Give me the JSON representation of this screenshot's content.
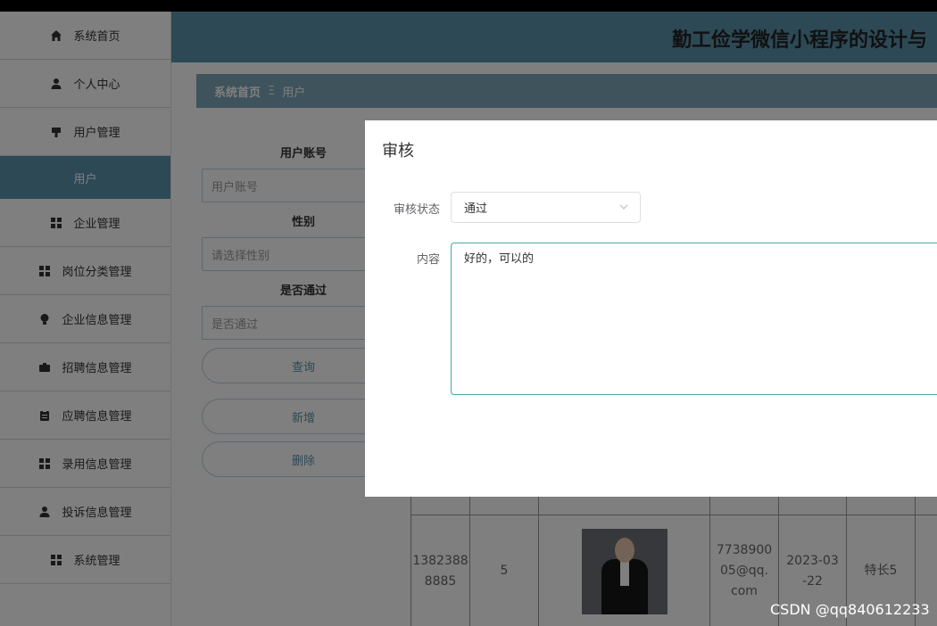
{
  "sidebar": {
    "items": [
      {
        "label": "系统首页",
        "icon": "home-icon"
      },
      {
        "label": "个人中心",
        "icon": "person-icon"
      },
      {
        "label": "用户管理",
        "icon": "user-manage-icon"
      },
      {
        "label": "用户",
        "icon": ""
      },
      {
        "label": "企业管理",
        "icon": "grid-icon"
      },
      {
        "label": "岗位分类管理",
        "icon": "grid-icon"
      },
      {
        "label": "企业信息管理",
        "icon": "bulb-icon"
      },
      {
        "label": "招聘信息管理",
        "icon": "briefcase-icon"
      },
      {
        "label": "应聘信息管理",
        "icon": "clipboard-icon"
      },
      {
        "label": "录用信息管理",
        "icon": "grid-icon"
      },
      {
        "label": "投诉信息管理",
        "icon": "person-icon"
      },
      {
        "label": "系统管理",
        "icon": "grid-icon"
      }
    ]
  },
  "header": {
    "title": "勤工俭学微信小程序的设计与"
  },
  "breadcrumb": {
    "home": "系统首页",
    "sep": "Ξ",
    "current": "用户"
  },
  "search": {
    "account_label": "用户账号",
    "account_placeholder": "用户账号",
    "gender_label": "性别",
    "gender_placeholder": "请选择性别",
    "pass_label": "是否通过",
    "pass_placeholder": "是否通过",
    "query_button": "查询",
    "add_button": "新增",
    "delete_button": "删除"
  },
  "table": {
    "row": {
      "account": "1382388 8885",
      "num": "5",
      "email": "7738900 05@qq. com",
      "date": "2023-03 -22",
      "skill": "特长5"
    }
  },
  "dialog": {
    "title": "审核",
    "status_label": "审核状态",
    "status_value": "通过",
    "content_label": "内容",
    "content_value": "好的，可以的"
  },
  "watermark": "CSDN @qq840612233",
  "colors": {
    "accent": "#5b93ad",
    "breadcrumb": "#7fa6b9",
    "textarea_border": "#48a7a7"
  }
}
